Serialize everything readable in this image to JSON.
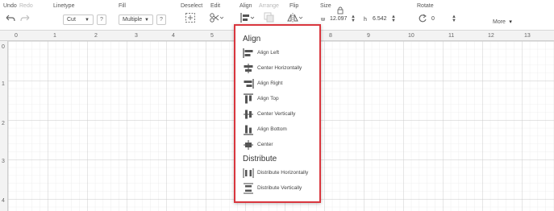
{
  "toolbar": {
    "undo": "Undo",
    "redo": "Redo",
    "linetype_label": "Linetype",
    "linetype_value": "Cut",
    "fill_label": "Fill",
    "fill_value": "Multiple",
    "help": "?",
    "deselect": "Deselect",
    "edit": "Edit",
    "align": "Align",
    "arrange": "Arrange",
    "flip": "Flip",
    "size_label": "Size",
    "width_prefix": "w",
    "width_value": "12.097",
    "height_prefix": "h",
    "height_value": "6.542",
    "rotate_label": "Rotate",
    "rotate_value": "0",
    "more": "More"
  },
  "ruler": {
    "top": [
      "0",
      "1",
      "2",
      "3",
      "4",
      "5",
      "6",
      "7",
      "8",
      "9",
      "10",
      "11",
      "12",
      "13"
    ],
    "left": [
      "0",
      "1",
      "2",
      "3",
      "4"
    ]
  },
  "align_menu": {
    "align_heading": "Align",
    "align_items": [
      "Align Left",
      "Center Horizontally",
      "Align Right",
      "Align Top",
      "Center Vertically",
      "Align Bottom",
      "Center"
    ],
    "distribute_heading": "Distribute",
    "distribute_items": [
      "Distribute Horizontally",
      "Distribute Vertically"
    ],
    "border_color": "#d9363e"
  }
}
